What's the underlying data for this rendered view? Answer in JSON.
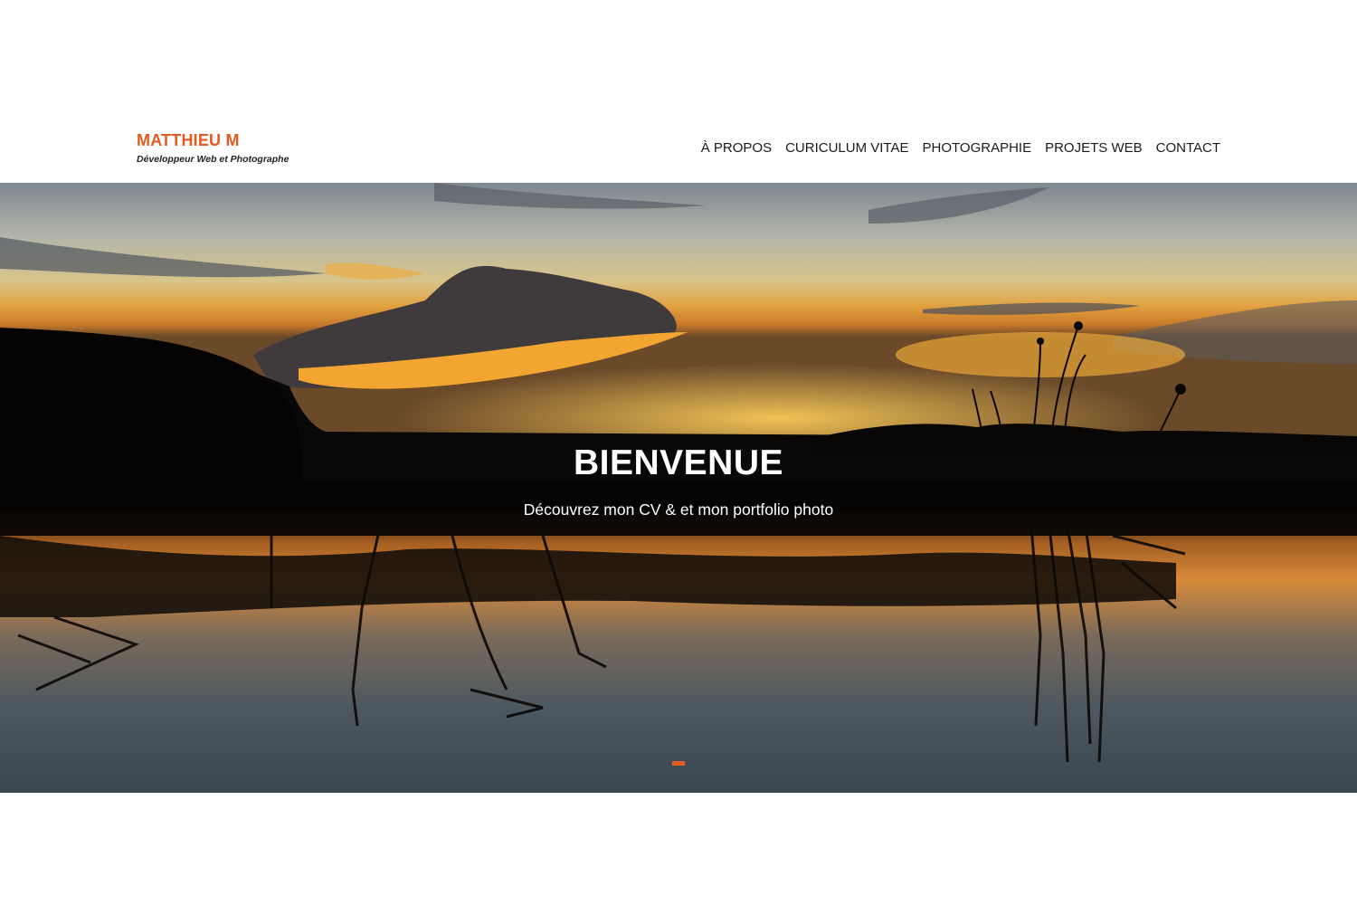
{
  "brand": {
    "name": "MATTHIEU M",
    "tagline": "Développeur Web et Photographe"
  },
  "nav": {
    "items": [
      {
        "label": "À PROPOS"
      },
      {
        "label": "CURICULUM VITAE"
      },
      {
        "label": "PHOTOGRAPHIE"
      },
      {
        "label": "PROJETS WEB"
      },
      {
        "label": "CONTACT"
      }
    ]
  },
  "hero": {
    "title": "BIENVENUE",
    "subtitle": "Découvrez mon CV & et mon portfolio photo",
    "slides_total": 1,
    "active_slide": 1
  },
  "colors": {
    "accent": "#e35a22",
    "nav_text": "#1a1a1a",
    "background": "#ffffff"
  }
}
